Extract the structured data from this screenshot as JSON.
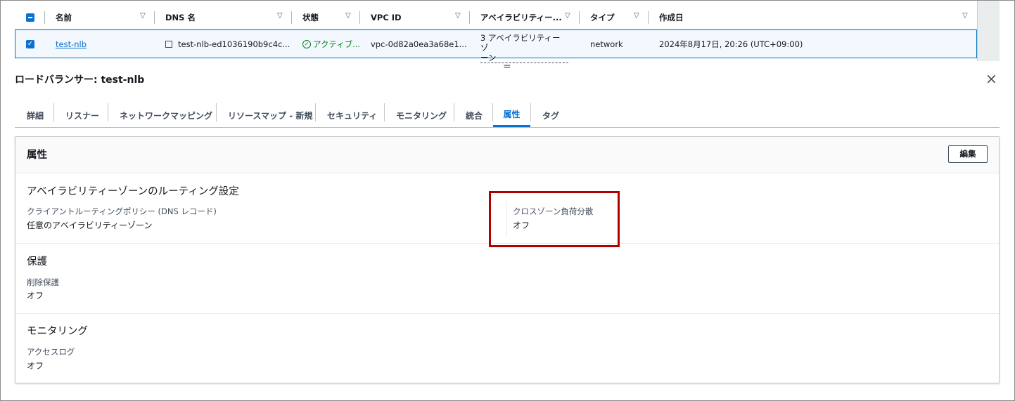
{
  "table": {
    "columns": [
      "名前",
      "DNS 名",
      "状態",
      "VPC ID",
      "アベイラビリティー...",
      "タイプ",
      "作成日"
    ],
    "row": {
      "selected": true,
      "name": "test-nlb",
      "dns": "test-nlb-ed1036190b9c4c...",
      "status": "アクティブ...",
      "vpc": "vpc-0d82a0ea3a68e1...",
      "az_line1": "3 アベイラビリティーゾ",
      "az_line2": "ーン",
      "type": "network",
      "created": "2024年8月17日, 20:26 (UTC+09:00)"
    }
  },
  "splitter": "=",
  "detail": {
    "title": "ロードバランサー: test-nlb",
    "close": "×",
    "tabs": [
      "詳細",
      "リスナー",
      "ネットワークマッピング",
      "リソースマップ - 新規",
      "セキュリティ",
      "モニタリング",
      "統合",
      "属性",
      "タグ"
    ],
    "active_tab": "属性"
  },
  "panel": {
    "title": "属性",
    "edit_label": "編集",
    "sections": [
      {
        "heading": "アベイラビリティーゾーンのルーティング設定",
        "fields": [
          {
            "label": "クライアントルーティングポリシー (DNS レコード)",
            "value": "任意のアベイラビリティーゾーン"
          },
          {
            "label": "クロスゾーン負荷分散",
            "value": "オフ"
          }
        ]
      },
      {
        "heading": "保護",
        "fields": [
          {
            "label": "削除保護",
            "value": "オフ"
          }
        ]
      },
      {
        "heading": "モニタリング",
        "fields": [
          {
            "label": "アクセスログ",
            "value": "オフ"
          }
        ]
      }
    ]
  },
  "colors": {
    "accent": "#0972d3",
    "success": "#037f0c",
    "highlight": "#b00000",
    "selected_bg": "#f2f8fd"
  }
}
